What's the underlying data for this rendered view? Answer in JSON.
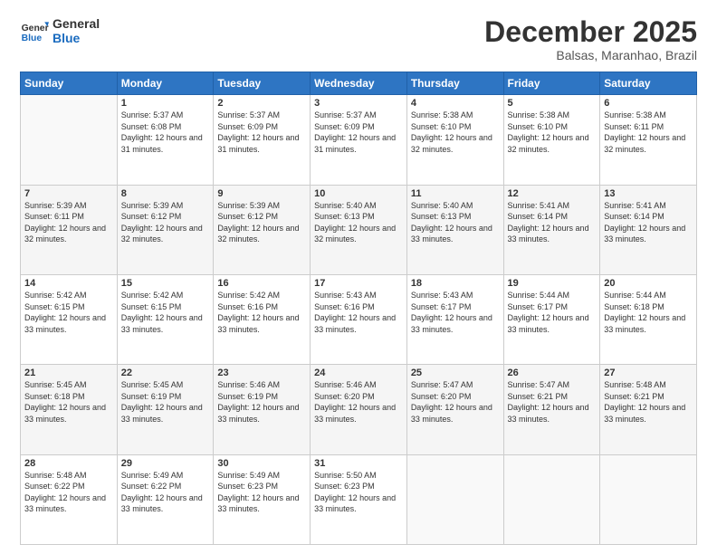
{
  "logo": {
    "text_general": "General",
    "text_blue": "Blue"
  },
  "header": {
    "month": "December 2025",
    "location": "Balsas, Maranhao, Brazil"
  },
  "days_of_week": [
    "Sunday",
    "Monday",
    "Tuesday",
    "Wednesday",
    "Thursday",
    "Friday",
    "Saturday"
  ],
  "weeks": [
    [
      {
        "day": null,
        "info": null
      },
      {
        "day": "1",
        "sunrise": "5:37 AM",
        "sunset": "6:08 PM",
        "daylight": "12 hours and 31 minutes."
      },
      {
        "day": "2",
        "sunrise": "5:37 AM",
        "sunset": "6:09 PM",
        "daylight": "12 hours and 31 minutes."
      },
      {
        "day": "3",
        "sunrise": "5:37 AM",
        "sunset": "6:09 PM",
        "daylight": "12 hours and 31 minutes."
      },
      {
        "day": "4",
        "sunrise": "5:38 AM",
        "sunset": "6:10 PM",
        "daylight": "12 hours and 32 minutes."
      },
      {
        "day": "5",
        "sunrise": "5:38 AM",
        "sunset": "6:10 PM",
        "daylight": "12 hours and 32 minutes."
      },
      {
        "day": "6",
        "sunrise": "5:38 AM",
        "sunset": "6:11 PM",
        "daylight": "12 hours and 32 minutes."
      }
    ],
    [
      {
        "day": "7",
        "sunrise": "5:39 AM",
        "sunset": "6:11 PM",
        "daylight": "12 hours and 32 minutes."
      },
      {
        "day": "8",
        "sunrise": "5:39 AM",
        "sunset": "6:12 PM",
        "daylight": "12 hours and 32 minutes."
      },
      {
        "day": "9",
        "sunrise": "5:39 AM",
        "sunset": "6:12 PM",
        "daylight": "12 hours and 32 minutes."
      },
      {
        "day": "10",
        "sunrise": "5:40 AM",
        "sunset": "6:13 PM",
        "daylight": "12 hours and 32 minutes."
      },
      {
        "day": "11",
        "sunrise": "5:40 AM",
        "sunset": "6:13 PM",
        "daylight": "12 hours and 33 minutes."
      },
      {
        "day": "12",
        "sunrise": "5:41 AM",
        "sunset": "6:14 PM",
        "daylight": "12 hours and 33 minutes."
      },
      {
        "day": "13",
        "sunrise": "5:41 AM",
        "sunset": "6:14 PM",
        "daylight": "12 hours and 33 minutes."
      }
    ],
    [
      {
        "day": "14",
        "sunrise": "5:42 AM",
        "sunset": "6:15 PM",
        "daylight": "12 hours and 33 minutes."
      },
      {
        "day": "15",
        "sunrise": "5:42 AM",
        "sunset": "6:15 PM",
        "daylight": "12 hours and 33 minutes."
      },
      {
        "day": "16",
        "sunrise": "5:42 AM",
        "sunset": "6:16 PM",
        "daylight": "12 hours and 33 minutes."
      },
      {
        "day": "17",
        "sunrise": "5:43 AM",
        "sunset": "6:16 PM",
        "daylight": "12 hours and 33 minutes."
      },
      {
        "day": "18",
        "sunrise": "5:43 AM",
        "sunset": "6:17 PM",
        "daylight": "12 hours and 33 minutes."
      },
      {
        "day": "19",
        "sunrise": "5:44 AM",
        "sunset": "6:17 PM",
        "daylight": "12 hours and 33 minutes."
      },
      {
        "day": "20",
        "sunrise": "5:44 AM",
        "sunset": "6:18 PM",
        "daylight": "12 hours and 33 minutes."
      }
    ],
    [
      {
        "day": "21",
        "sunrise": "5:45 AM",
        "sunset": "6:18 PM",
        "daylight": "12 hours and 33 minutes."
      },
      {
        "day": "22",
        "sunrise": "5:45 AM",
        "sunset": "6:19 PM",
        "daylight": "12 hours and 33 minutes."
      },
      {
        "day": "23",
        "sunrise": "5:46 AM",
        "sunset": "6:19 PM",
        "daylight": "12 hours and 33 minutes."
      },
      {
        "day": "24",
        "sunrise": "5:46 AM",
        "sunset": "6:20 PM",
        "daylight": "12 hours and 33 minutes."
      },
      {
        "day": "25",
        "sunrise": "5:47 AM",
        "sunset": "6:20 PM",
        "daylight": "12 hours and 33 minutes."
      },
      {
        "day": "26",
        "sunrise": "5:47 AM",
        "sunset": "6:21 PM",
        "daylight": "12 hours and 33 minutes."
      },
      {
        "day": "27",
        "sunrise": "5:48 AM",
        "sunset": "6:21 PM",
        "daylight": "12 hours and 33 minutes."
      }
    ],
    [
      {
        "day": "28",
        "sunrise": "5:48 AM",
        "sunset": "6:22 PM",
        "daylight": "12 hours and 33 minutes."
      },
      {
        "day": "29",
        "sunrise": "5:49 AM",
        "sunset": "6:22 PM",
        "daylight": "12 hours and 33 minutes."
      },
      {
        "day": "30",
        "sunrise": "5:49 AM",
        "sunset": "6:23 PM",
        "daylight": "12 hours and 33 minutes."
      },
      {
        "day": "31",
        "sunrise": "5:50 AM",
        "sunset": "6:23 PM",
        "daylight": "12 hours and 33 minutes."
      },
      {
        "day": null,
        "info": null
      },
      {
        "day": null,
        "info": null
      },
      {
        "day": null,
        "info": null
      }
    ]
  ]
}
